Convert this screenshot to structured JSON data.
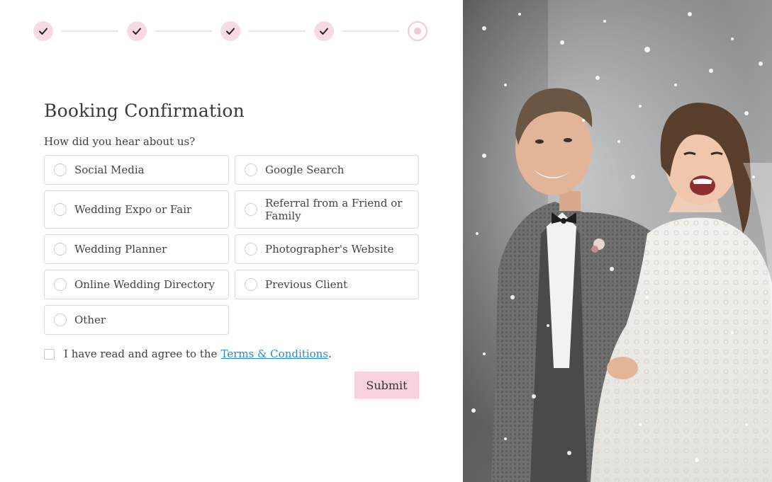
{
  "stepper": {
    "steps": [
      {
        "state": "done",
        "icon": "check-icon"
      },
      {
        "state": "done",
        "icon": "check-icon"
      },
      {
        "state": "done",
        "icon": "check-icon"
      },
      {
        "state": "done",
        "icon": "check-icon"
      },
      {
        "state": "current",
        "icon": "current-dot-icon"
      }
    ]
  },
  "form": {
    "title": "Booking Confirmation",
    "question": "How did you hear about us?",
    "options": [
      "Social Media",
      "Google Search",
      "Wedding Expo or Fair",
      "Referral from a Friend or Family",
      "Wedding Planner",
      "Photographer's Website",
      "Online Wedding Directory",
      "Previous Client",
      "Other"
    ],
    "terms_prefix": "I have read and agree to the",
    "terms_link": "Terms & Conditions",
    "terms_suffix": ".",
    "submit_label": "Submit"
  },
  "colors": {
    "accent_pink": "#f9d2dd",
    "link_blue": "#2a8bd4",
    "border_gray": "#dcdcdc"
  },
  "photo": {
    "subject": "wedding-couple-photo"
  }
}
